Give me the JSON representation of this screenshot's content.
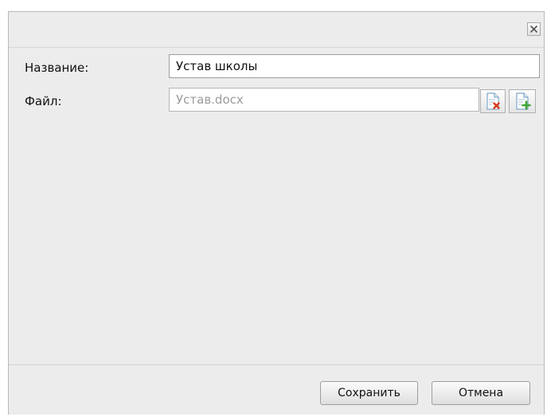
{
  "dialog": {
    "close_icon": "close-icon",
    "fields": {
      "name_label": "Название:",
      "name_value": "Устав школы",
      "file_label": "Файл:",
      "file_value": "Устав.docx"
    },
    "file_actions": {
      "remove_icon": "document-remove-icon",
      "add_icon": "document-add-icon"
    },
    "footer": {
      "save_label": "Сохранить",
      "cancel_label": "Отмена"
    }
  },
  "colors": {
    "panel_bg": "#ececec",
    "remove_accent": "#d9381e",
    "add_accent": "#3fa535",
    "doc_tint": "#7fa7c9"
  }
}
